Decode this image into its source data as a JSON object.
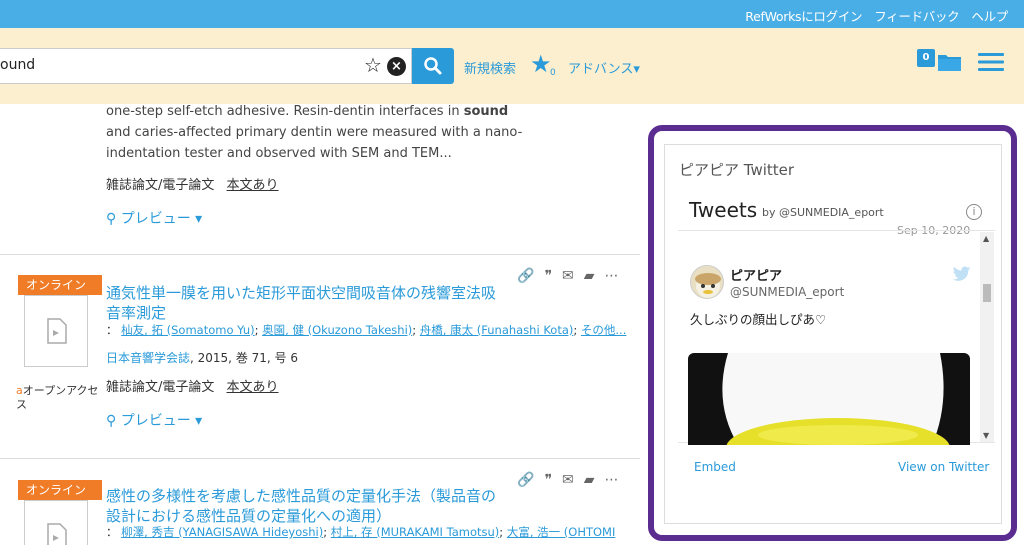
{
  "header": {
    "links": [
      "RefWorksにログイン",
      "フィードバック",
      "ヘルプ"
    ]
  },
  "search": {
    "value": "ound",
    "new_search": "新規検索",
    "favorites_count": "0",
    "advanced": "アドバンス▾",
    "folder_count": "0"
  },
  "results": {
    "item1": {
      "abstract": [
        "one-step self-etch adhesive. Resin-dentin interfaces in",
        "and caries-affected primary dentin were measured with a nano-",
        "indentation tester and observed with SEM and TEM..."
      ],
      "keyword": "sound",
      "type": "雑誌論文/電子論文",
      "fulltext": "本文あり",
      "preview": "プレビュー ▾"
    },
    "item2": {
      "badge": "オンライン",
      "oa": "オープンアクセス",
      "title": "通気性単一膜を用いた矩形平面状空間吸音体の残響室法吸音率測定",
      "authors_prefix": "：",
      "authors": [
        "杣友, 拓 (Somatomo Yu)",
        "奥園, 健 (Okuzono Takeshi)",
        "舟橋, 康太 (Funahashi Kota)",
        "その他..."
      ],
      "journal": "日本音響学会誌",
      "journal_info": ", 2015, 巻 71, 号 6",
      "type": "雑誌論文/電子論文",
      "fulltext": "本文あり",
      "preview": "プレビュー ▾"
    },
    "item3": {
      "badge": "オンライン",
      "title": "感性の多様性を考慮した感性品質の定量化手法（製品音の設計における感性品質の定量化への適用）",
      "authors_prefix": "：",
      "authors": [
        "柳澤, 秀吉 (YANAGISAWA Hideyoshi)",
        "村上, 存 (MURAKAMI Tamotsu)",
        "大富, 浩一 (OHTOMI"
      ]
    }
  },
  "widget": {
    "title": "ピアピア Twitter",
    "tweets_header": "Tweets",
    "tweets_by": "by @SUNMEDIA_eport",
    "prev_date": "Sep 10, 2020",
    "tweet": {
      "name": "ピアピア",
      "handle": "@SUNMEDIA_eport",
      "text": "久しぶりの顔出しぴあ♡"
    },
    "embed": "Embed",
    "view_on_twitter": "View on Twitter"
  },
  "colors": {
    "accent": "#2a9ad9",
    "topbar": "#4aaee6",
    "search_bg": "#fcefcf",
    "badge": "#f07c28",
    "highlight_border": "#5c2d91"
  }
}
